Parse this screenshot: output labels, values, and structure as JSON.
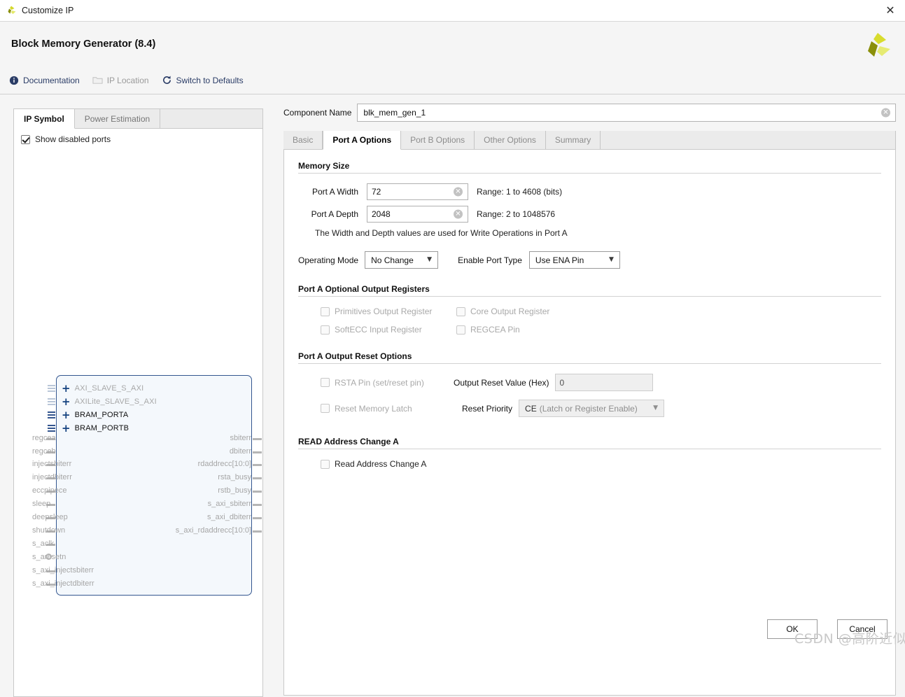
{
  "window": {
    "title": "Customize IP",
    "close_label": "✕",
    "app_title": "Block Memory Generator (8.4)",
    "logo_icon": "xilinx-logo-icon"
  },
  "links": [
    {
      "label": "Documentation",
      "icon": "info-icon",
      "disabled": false
    },
    {
      "label": "IP Location",
      "icon": "folder-icon",
      "disabled": true
    },
    {
      "label": "Switch to Defaults",
      "icon": "refresh-icon",
      "disabled": false
    }
  ],
  "left_panel": {
    "tabs": [
      {
        "label": "IP Symbol",
        "active": true
      },
      {
        "label": "Power Estimation",
        "active": false
      }
    ],
    "show_disabled_ports": {
      "label": "Show disabled ports",
      "checked": true
    },
    "symbol": {
      "buses": [
        {
          "name": "AXI_SLAVE_S_AXI",
          "enabled": false
        },
        {
          "name": "AXILite_SLAVE_S_AXI",
          "enabled": false
        },
        {
          "name": "BRAM_PORTA",
          "enabled": true
        },
        {
          "name": "BRAM_PORTB",
          "enabled": true
        }
      ],
      "left_pins": [
        "regcea",
        "regceb",
        "injectsbiterr",
        "injectdbiterr",
        "eccpipece",
        "sleep",
        "deepsleep",
        "shutdown",
        "s_aclk",
        "s_aresetn",
        "s_axi_injectsbiterr",
        "s_axi_injectdbiterr"
      ],
      "right_pins": [
        "sbiterr",
        "dbiterr",
        "rdaddrecc[10:0]",
        "rsta_busy",
        "rstb_busy",
        "s_axi_sbiterr",
        "s_axi_dbiterr",
        "s_axi_rdaddrecc[10:0]"
      ]
    }
  },
  "right_panel": {
    "component_name": {
      "label": "Component Name",
      "value": "blk_mem_gen_1",
      "clear_icon": "clear-circle-icon"
    },
    "tabs": [
      {
        "label": "Basic",
        "active": false
      },
      {
        "label": "Port A Options",
        "active": true
      },
      {
        "label": "Port B Options",
        "active": false
      },
      {
        "label": "Other Options",
        "active": false
      },
      {
        "label": "Summary",
        "active": false
      }
    ],
    "memory_size": {
      "title": "Memory Size",
      "width": {
        "label": "Port A Width",
        "value": "72",
        "range": "Range: 1 to 4608 (bits)"
      },
      "depth": {
        "label": "Port A Depth",
        "value": "2048",
        "range": "Range: 2 to 1048576"
      },
      "note": "The Width and Depth values are used for Write Operations in Port A"
    },
    "operating": {
      "mode_label": "Operating Mode",
      "mode_value": "No Change",
      "enable_label": "Enable Port Type",
      "enable_value": "Use ENA Pin"
    },
    "optional_output_registers": {
      "title": "Port A Optional Output Registers",
      "items": [
        {
          "label": "Primitives Output Register",
          "checked": false,
          "disabled": true
        },
        {
          "label": "Core Output Register",
          "checked": false,
          "disabled": true
        },
        {
          "label": "SoftECC Input Register",
          "checked": false,
          "disabled": true
        },
        {
          "label": "REGCEA Pin",
          "checked": false,
          "disabled": true
        }
      ]
    },
    "output_reset_options": {
      "title": "Port A Output Reset Options",
      "rsta_pin": {
        "label": "RSTA Pin (set/reset pin)",
        "checked": false,
        "disabled": true
      },
      "reset_memory_latch": {
        "label": "Reset Memory Latch",
        "checked": false,
        "disabled": true
      },
      "reset_value": {
        "label": "Output Reset Value (Hex)",
        "value": "0"
      },
      "reset_priority": {
        "label": "Reset Priority",
        "value_main": "CE",
        "value_sub": "(Latch or Register Enable)"
      }
    },
    "read_address_change": {
      "title": "READ Address Change A",
      "checkbox": {
        "label": "Read Address Change A",
        "checked": false,
        "disabled": true
      }
    }
  },
  "footer": {
    "ok_label": "OK",
    "cancel_label": "Cancel"
  },
  "watermark": "CSDN @高阶近似"
}
